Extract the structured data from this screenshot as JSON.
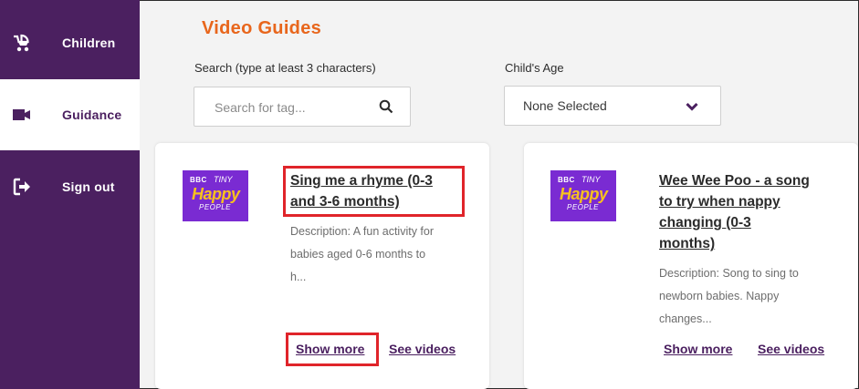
{
  "sidebar": {
    "items": [
      {
        "label": "Children",
        "icon": "stroller-icon",
        "active": false
      },
      {
        "label": "Guidance",
        "icon": "video-camera-icon",
        "active": true
      },
      {
        "label": "Sign out",
        "icon": "sign-out-icon",
        "active": false
      }
    ]
  },
  "page": {
    "title": "Video Guides"
  },
  "search": {
    "label": "Search (type at least 3 characters)",
    "placeholder": "Search for tag...",
    "value": ""
  },
  "age_filter": {
    "label": "Child's Age",
    "selected": "None Selected"
  },
  "cards": [
    {
      "thumb": {
        "bbc": "BBC",
        "tiny": "TINY",
        "happy": "Happy",
        "people": "PEOPLE"
      },
      "title_line1": "Sing me a rhyme (0-3",
      "title_line2": "and 3-6 months)",
      "desc_line1": "Description: A fun activity for",
      "desc_line2": "babies aged 0-6 months to",
      "desc_line3": "h...",
      "show_more": "Show more",
      "see_videos": "See videos"
    },
    {
      "thumb": {
        "bbc": "BBC",
        "tiny": "TINY",
        "happy": "Happy",
        "people": "PEOPLE"
      },
      "title_line1": "Wee Wee Poo - a song",
      "title_line2": "to try when nappy",
      "title_line3": "changing (0-3",
      "title_line4": "months)",
      "desc_line1": "Description: Song to sing to",
      "desc_line2": "newborn babies. Nappy",
      "desc_line3": "changes...",
      "show_more": "Show more",
      "see_videos": "See videos"
    }
  ],
  "colors": {
    "sidebar": "#4b2060",
    "title": "#e8661c",
    "link": "#4b2060",
    "thumb_bg": "#7a2bd2",
    "highlight": "#e0242a"
  }
}
